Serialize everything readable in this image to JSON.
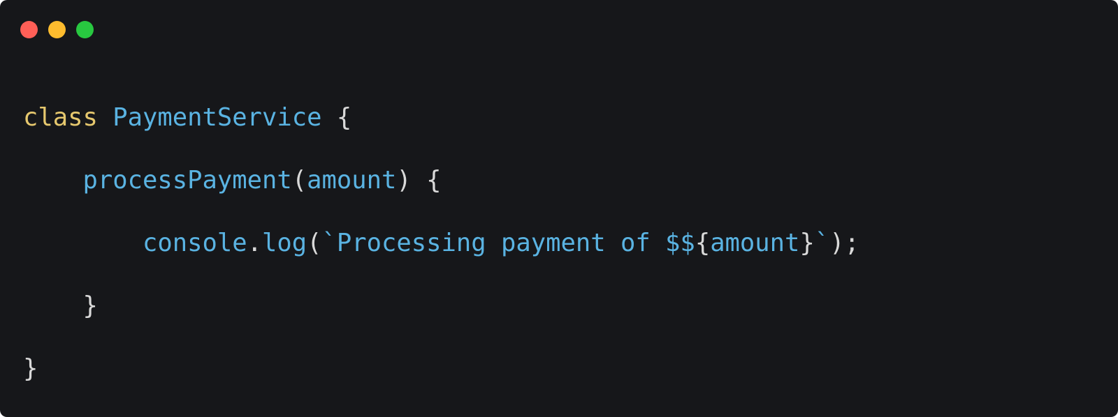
{
  "window": {
    "background": "#16171a",
    "controls": {
      "close_color": "#ff5f57",
      "minimize_color": "#febc2e",
      "maximize_color": "#28c840"
    }
  },
  "code": {
    "colors": {
      "keyword": "#e6c86e",
      "identifier": "#5ab3e2",
      "punctuation": "#d9d9d9"
    },
    "lines": [
      {
        "keyword": "class",
        "class_name": "PaymentService",
        "open": "{"
      },
      {
        "indent": "    ",
        "method": "processPayment",
        "paren_open": "(",
        "param": "amount",
        "paren_close": ")",
        "open": "{"
      },
      {
        "indent": "        ",
        "object": "console",
        "dot": ".",
        "call": "log",
        "paren_open": "(",
        "str_start": "`Processing payment of $$",
        "interp_open": "{",
        "interp_var": "amount",
        "interp_close": "}",
        "str_end": "`",
        "paren_close": ");"
      },
      {
        "indent": "    ",
        "close": "}"
      },
      {
        "close": "}"
      }
    ]
  }
}
